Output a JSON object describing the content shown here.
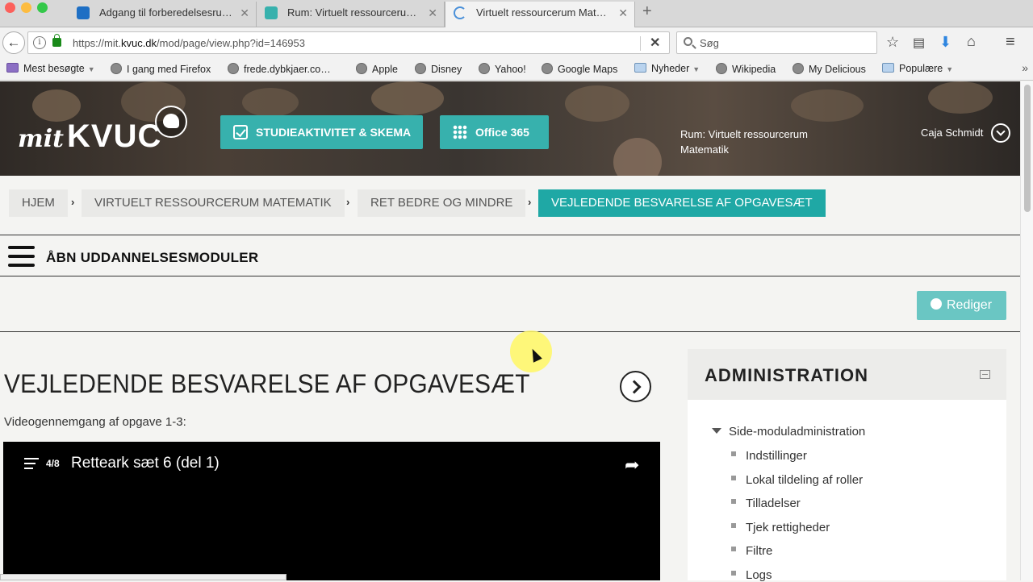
{
  "browser": {
    "tabs": [
      {
        "title": "Adgang til forberedelsesru…",
        "favicon_color": "#1e6fc4"
      },
      {
        "title": "Rum: Virtuelt ressourcerum …",
        "favicon_color": "#37b1ad"
      },
      {
        "title": "Virtuelt ressourcerum Mate…",
        "favicon_color": "#4a90d9"
      }
    ],
    "url": {
      "prefix": "https://mit.",
      "domain": "kvuc.dk",
      "path": "/mod/page/view.php?id=146953"
    },
    "search_placeholder": "Søg",
    "bookmarks": [
      {
        "label": "Mest besøgte",
        "dropdown": true,
        "icon": "most-visited-icon"
      },
      {
        "label": "I gang med Firefox",
        "icon": "globe-icon"
      },
      {
        "label": "frede.dybkjaer.co…",
        "icon": "globe-icon"
      },
      {
        "label": "Apple",
        "icon": "globe-icon"
      },
      {
        "label": "Disney",
        "icon": "globe-icon"
      },
      {
        "label": "Yahoo!",
        "icon": "globe-icon"
      },
      {
        "label": "Google Maps",
        "icon": "globe-icon"
      },
      {
        "label": "Nyheder",
        "dropdown": true,
        "icon": "folder-icon"
      },
      {
        "label": "Wikipedia",
        "icon": "globe-icon"
      },
      {
        "label": "My Delicious",
        "icon": "globe-icon"
      },
      {
        "label": "Populære",
        "dropdown": true,
        "icon": "folder-icon"
      }
    ],
    "more_label": "»",
    "new_tab_label": "+"
  },
  "header": {
    "logo_mit": "mit",
    "logo_kvuc": "KVUC",
    "buttons": {
      "schedule": "STUDIEAKTIVITET & SKEMA",
      "office": "Office 365"
    },
    "room": "Rum: Virtuelt ressourcerum Matematik",
    "user": "Caja Schmidt",
    "accent": "#37b1ad"
  },
  "breadcrumb": [
    "HJEM",
    "VIRTUELT RESSOURCERUM MATEMATIK",
    "RET BEDRE OG MINDRE",
    "VEJLEDENDE BESVARELSE AF OPGAVESÆT"
  ],
  "modules_label": "ÅBN UDDANNELSESMODULER",
  "edit_label": "Rediger",
  "main": {
    "title": "VEJLEDENDE BESVARELSE AF OPGAVESÆT",
    "intro": "Videogennemgang af opgave 1-3:",
    "video": {
      "count": "4/8",
      "title": "Retteark sæt 6 (del 1)"
    }
  },
  "admin": {
    "title": "ADMINISTRATION",
    "root": "Side-moduladministration",
    "items": [
      "Indstillinger",
      "Lokal tildeling af roller",
      "Tilladelser",
      "Tjek rettigheder",
      "Filtre",
      "Logs"
    ]
  }
}
